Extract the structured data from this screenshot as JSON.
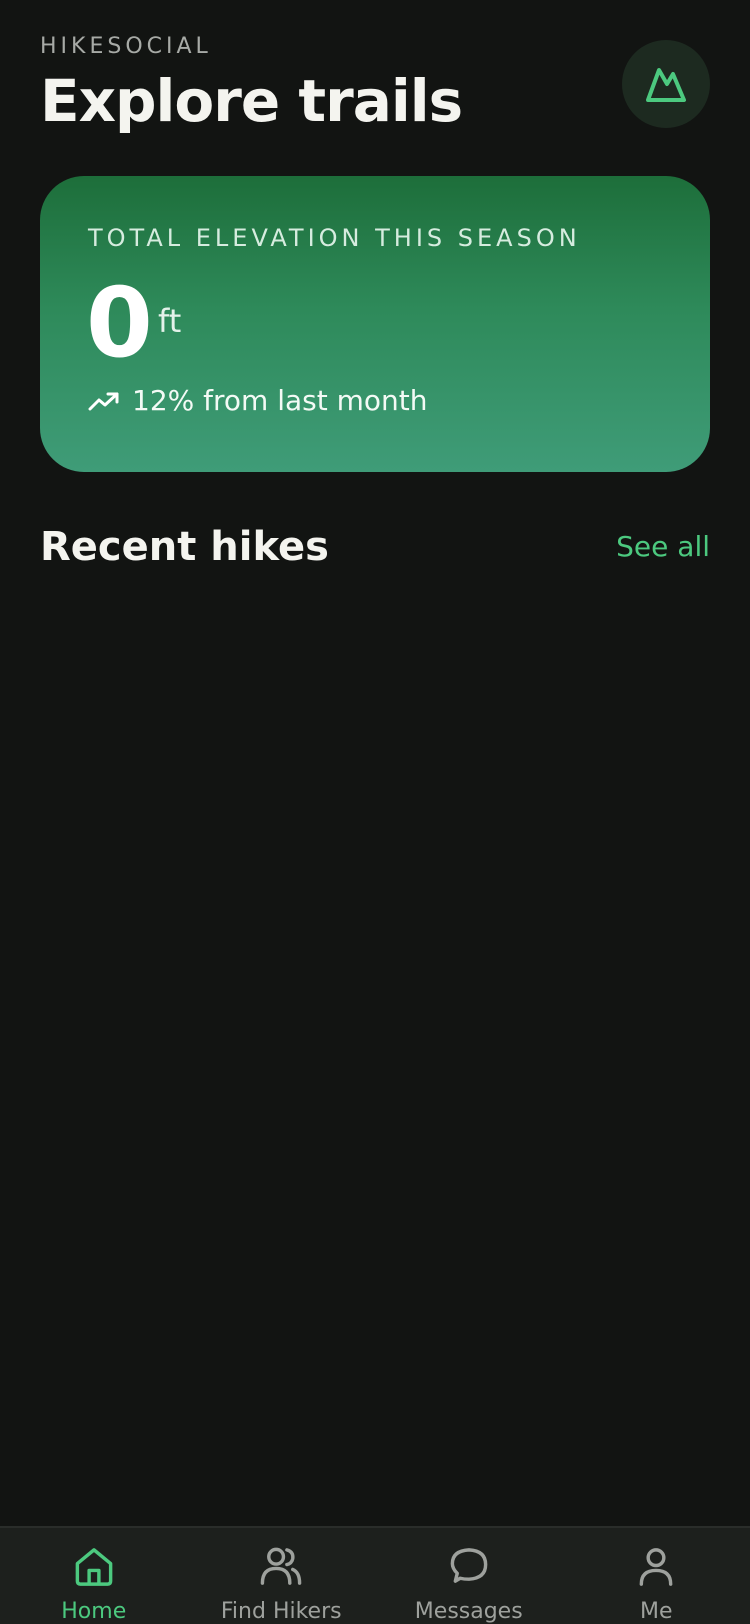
{
  "header": {
    "app_label": "HIKESOCIAL",
    "title": "Explore trails",
    "profile_icon": "mountain-icon"
  },
  "stats_card": {
    "label": "TOTAL ELEVATION THIS SEASON",
    "value": "0",
    "unit": "ft",
    "trend_icon": "trending-up-icon",
    "trend_text": "12% from last month"
  },
  "recent_hikes": {
    "title": "Recent hikes",
    "see_all_label": "See all"
  },
  "tab_bar": {
    "tabs": [
      {
        "label": "Home",
        "icon": "home-icon",
        "active": true
      },
      {
        "label": "Find Hikers",
        "icon": "users-icon",
        "active": false
      },
      {
        "label": "Messages",
        "icon": "message-icon",
        "active": false
      },
      {
        "label": "Me",
        "icon": "user-icon",
        "active": false
      }
    ]
  },
  "colors": {
    "background": "#121412",
    "accent": "#4cc97f",
    "card_gradient_top": "#1d6e3a",
    "card_gradient_bottom": "#3f9c78",
    "tab_bar": "#1d201d"
  }
}
